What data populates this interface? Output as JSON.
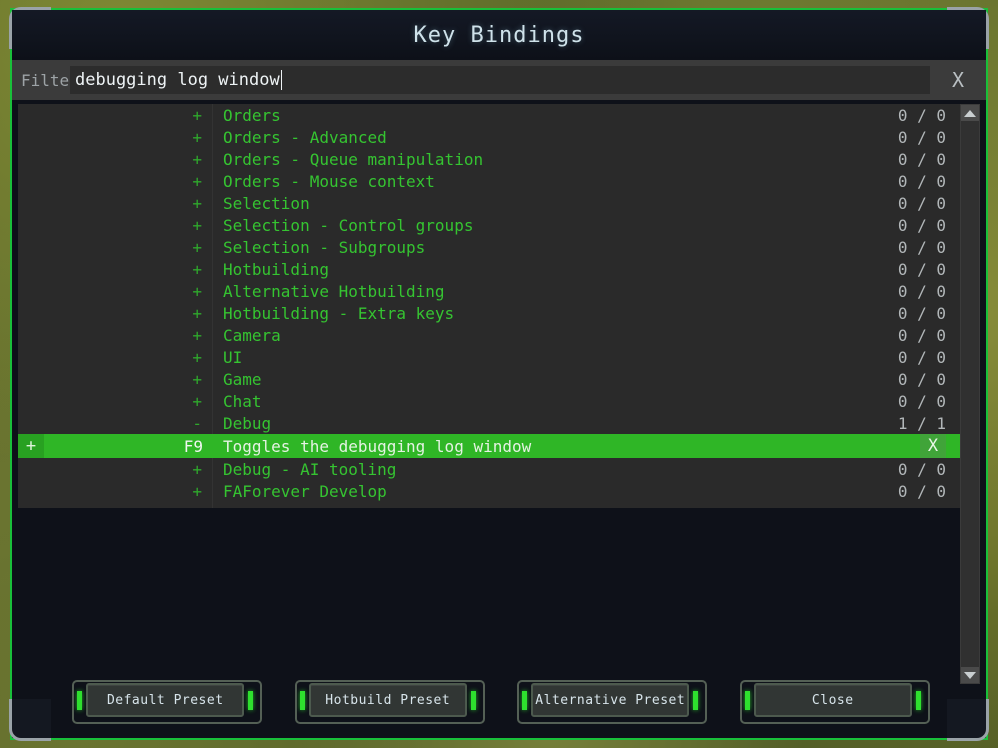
{
  "window": {
    "title": "Key Bindings"
  },
  "filter": {
    "label": "Filter",
    "value": "debugging log window",
    "placeholder": "",
    "clear_label": "X"
  },
  "list": {
    "rows": [
      {
        "expander": "+",
        "label": "Orders",
        "count": "0 / 0",
        "type": "category"
      },
      {
        "expander": "+",
        "label": "Orders - Advanced",
        "count": "0 / 0",
        "type": "category"
      },
      {
        "expander": "+",
        "label": "Orders - Queue manipulation",
        "count": "0 / 0",
        "type": "category"
      },
      {
        "expander": "+",
        "label": "Orders - Mouse context",
        "count": "0 / 0",
        "type": "category"
      },
      {
        "expander": "+",
        "label": "Selection",
        "count": "0 / 0",
        "type": "category"
      },
      {
        "expander": "+",
        "label": "Selection - Control groups",
        "count": "0 / 0",
        "type": "category"
      },
      {
        "expander": "+",
        "label": "Selection - Subgroups",
        "count": "0 / 0",
        "type": "category"
      },
      {
        "expander": "+",
        "label": "Hotbuilding",
        "count": "0 / 0",
        "type": "category"
      },
      {
        "expander": "+",
        "label": "Alternative Hotbuilding",
        "count": "0 / 0",
        "type": "category"
      },
      {
        "expander": "+",
        "label": "Hotbuilding - Extra keys",
        "count": "0 / 0",
        "type": "category"
      },
      {
        "expander": "+",
        "label": "Camera",
        "count": "0 / 0",
        "type": "category"
      },
      {
        "expander": "+",
        "label": "UI",
        "count": "0 / 0",
        "type": "category"
      },
      {
        "expander": "+",
        "label": "Game",
        "count": "0 / 0",
        "type": "category"
      },
      {
        "expander": "+",
        "label": "Chat",
        "count": "0 / 0",
        "type": "category"
      },
      {
        "expander": "-",
        "label": "Debug",
        "count": "1 / 1",
        "type": "category"
      },
      {
        "add_label": "+",
        "key": "F9",
        "label": "Toggles the debugging log window",
        "delete_label": "X",
        "type": "binding"
      },
      {
        "expander": "+",
        "label": "Debug - AI tooling",
        "count": "0 / 0",
        "type": "category"
      },
      {
        "expander": "+",
        "label": "FAForever Develop",
        "count": "0 / 0",
        "type": "category"
      }
    ]
  },
  "scrollbar": {
    "up_arrow": "scroll-up-arrow",
    "down_arrow": "scroll-down-arrow"
  },
  "buttons": [
    {
      "label": "Default Preset"
    },
    {
      "label": "Hotbuild Preset"
    },
    {
      "label": "Alternative Preset"
    },
    {
      "label": "Close"
    }
  ],
  "colors": {
    "accent_green": "#2fb626",
    "text_green": "#35c431",
    "title_text": "#cfe2ea",
    "list_bg": "#2a2a2a",
    "window_bg": "#0e1119",
    "border_green": "#19c03a"
  }
}
